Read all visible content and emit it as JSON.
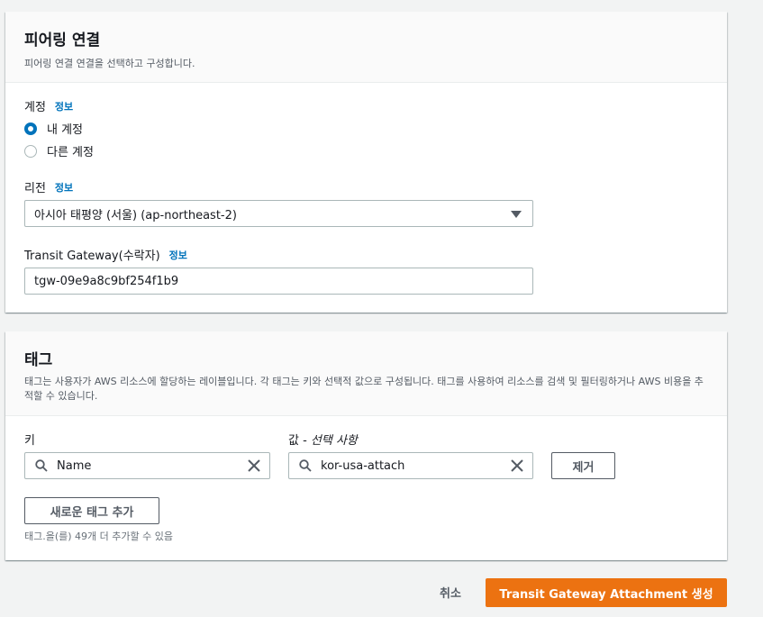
{
  "peering": {
    "title": "피어링 연결",
    "description": "피어링 연결 연결을 선택하고 구성합니다.",
    "account_label": "계정",
    "info_label": "정보",
    "account_options": [
      {
        "label": "내 계정",
        "checked": true
      },
      {
        "label": "다른 계정",
        "checked": false
      }
    ],
    "region_label": "리전",
    "region_value": "아시아 태평양 (서울) (ap-northeast-2)",
    "tgw_label": "Transit Gateway(수락자)",
    "tgw_value": "tgw-09e9a8c9bf254f1b9"
  },
  "tags": {
    "title": "태그",
    "description": "태그는 사용자가 AWS 리소스에 할당하는 레이블입니다. 각 태그는 키와 선택적 값으로 구성됩니다. 태그를 사용하여 리소스를 검색 및 필터링하거나 AWS 비용을 추적할 수 있습니다.",
    "key_label": "키",
    "value_label_prefix": "값 - ",
    "value_label_optional": "선택 사항",
    "key_value": "Name",
    "value_value": "kor-usa-attach",
    "remove_label": "제거",
    "add_label": "새로운 태그 추가",
    "hint": "태그.을(를) 49개 더 추가할 수 있음"
  },
  "footer": {
    "cancel_label": "취소",
    "create_label": "Transit Gateway Attachment 생성"
  },
  "colors": {
    "accent": "#0073bb",
    "primary": "#ec7211"
  }
}
